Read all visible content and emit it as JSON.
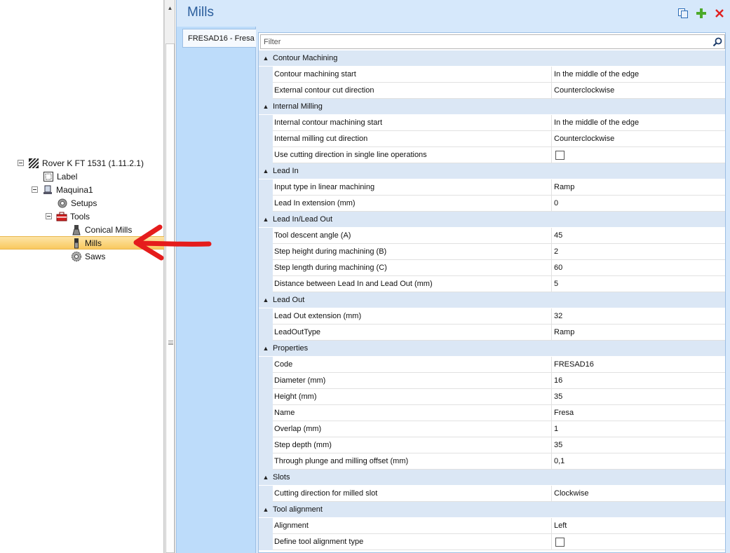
{
  "tree": {
    "root": {
      "label": "Rover K FT 1531 (1.11.2.1)",
      "icon": "machine-icon"
    },
    "label_node": {
      "label": "Label",
      "icon": "label-icon"
    },
    "machine": {
      "label": "Maquina1",
      "icon": "machine-stand-icon"
    },
    "setups": {
      "label": "Setups",
      "icon": "gear-icon"
    },
    "tools": {
      "label": "Tools",
      "icon": "toolbox-icon"
    },
    "conical_mills": {
      "label": "Conical Mills",
      "icon": "conical-mill-icon"
    },
    "mills": {
      "label": "Mills",
      "icon": "mill-icon",
      "selected": true
    },
    "saws": {
      "label": "Saws",
      "icon": "saw-gear-icon"
    }
  },
  "header": {
    "title": "Mills",
    "copy_icon": "copy-icon",
    "add_icon": "add-icon",
    "delete_icon": "delete-icon"
  },
  "tab": {
    "label": "FRESAD16 - Fresa"
  },
  "filter": {
    "placeholder": "Filter",
    "value": ""
  },
  "categories": [
    {
      "name": "Contour Machining",
      "properties": [
        {
          "name": "Contour machining start",
          "value": "In the middle of the edge"
        },
        {
          "name": "External contour cut direction",
          "value": "Counterclockwise"
        }
      ]
    },
    {
      "name": "Internal Milling",
      "properties": [
        {
          "name": "Internal contour machining start",
          "value": "In the middle of the edge"
        },
        {
          "name": "Internal milling cut direction",
          "value": "Counterclockwise"
        },
        {
          "name": "Use cutting direction in single line operations",
          "value": "",
          "checkbox": true,
          "checked": false
        }
      ]
    },
    {
      "name": "Lead In",
      "properties": [
        {
          "name": "Input type in linear machining",
          "value": "Ramp"
        },
        {
          "name": "Lead In extension (mm)",
          "value": "0"
        }
      ]
    },
    {
      "name": "Lead In/Lead Out",
      "properties": [
        {
          "name": "Tool descent angle (A)",
          "value": "45"
        },
        {
          "name": "Step height during machining (B)",
          "value": "2"
        },
        {
          "name": "Step length during machining (C)",
          "value": "60"
        },
        {
          "name": "Distance between Lead In and Lead Out (mm)",
          "value": "5"
        }
      ]
    },
    {
      "name": "Lead Out",
      "properties": [
        {
          "name": "Lead Out extension (mm)",
          "value": "32"
        },
        {
          "name": "LeadOutType",
          "value": "Ramp"
        }
      ]
    },
    {
      "name": "Properties",
      "properties": [
        {
          "name": "Code",
          "value": "FRESAD16"
        },
        {
          "name": "Diameter (mm)",
          "value": "16"
        },
        {
          "name": "Height (mm)",
          "value": "35"
        },
        {
          "name": "Name",
          "value": "Fresa"
        },
        {
          "name": "Overlap (mm)",
          "value": "1"
        },
        {
          "name": "Step depth (mm)",
          "value": "35"
        },
        {
          "name": "Through plunge and milling offset (mm)",
          "value": "0,1"
        }
      ]
    },
    {
      "name": "Slots",
      "properties": [
        {
          "name": "Cutting direction for milled slot",
          "value": "Clockwise"
        }
      ]
    },
    {
      "name": "Tool alignment",
      "properties": [
        {
          "name": "Alignment",
          "value": "Left"
        },
        {
          "name": "Define tool alignment type",
          "value": "",
          "checkbox": true,
          "checked": false
        }
      ]
    }
  ],
  "colors": {
    "accent_title": "#2a5d9c",
    "selection": "#f9c95f",
    "category_bg": "#dbe7f5",
    "panel_bg": "#d6e8fb",
    "annotation_arrow": "#e51c1c"
  }
}
